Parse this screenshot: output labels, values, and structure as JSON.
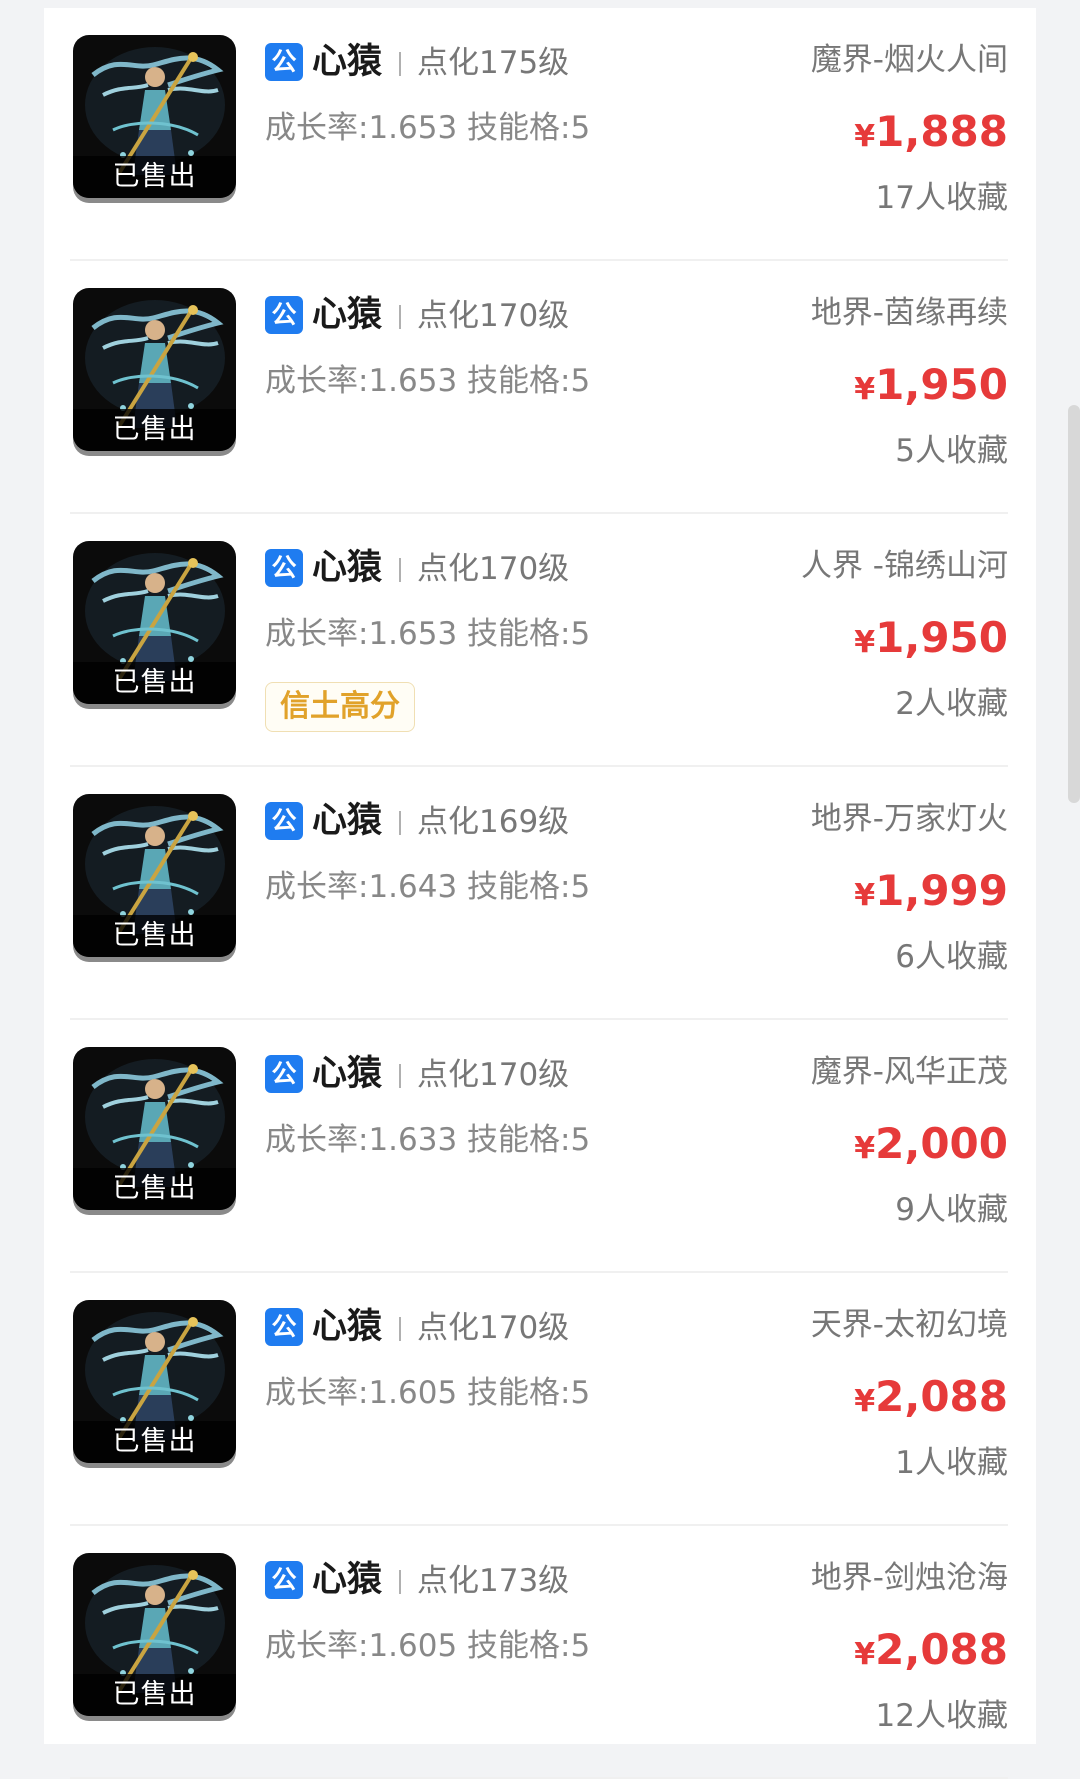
{
  "items": [
    {
      "badge": "公",
      "name": "心猿",
      "level": "点化175级",
      "stats": "成长率:1.653 技能格:5",
      "tag": "",
      "server": "魔界-烟火人间",
      "currency": "¥",
      "price": "1,888",
      "favorites": "17人收藏",
      "status": "已售出"
    },
    {
      "badge": "公",
      "name": "心猿",
      "level": "点化170级",
      "stats": "成长率:1.653 技能格:5",
      "tag": "",
      "server": "地界-茵缘再续",
      "currency": "¥",
      "price": "1,950",
      "favorites": "5人收藏",
      "status": "已售出"
    },
    {
      "badge": "公",
      "name": "心猿",
      "level": "点化170级",
      "stats": "成长率:1.653 技能格:5",
      "tag": "信土高分",
      "server": "人界 -锦绣山河",
      "currency": "¥",
      "price": "1,950",
      "favorites": "2人收藏",
      "status": "已售出"
    },
    {
      "badge": "公",
      "name": "心猿",
      "level": "点化169级",
      "stats": "成长率:1.643 技能格:5",
      "tag": "",
      "server": "地界-万家灯火",
      "currency": "¥",
      "price": "1,999",
      "favorites": "6人收藏",
      "status": "已售出"
    },
    {
      "badge": "公",
      "name": "心猿",
      "level": "点化170级",
      "stats": "成长率:1.633 技能格:5",
      "tag": "",
      "server": "魔界-风华正茂",
      "currency": "¥",
      "price": "2,000",
      "favorites": "9人收藏",
      "status": "已售出"
    },
    {
      "badge": "公",
      "name": "心猿",
      "level": "点化170级",
      "stats": "成长率:1.605 技能格:5",
      "tag": "",
      "server": "天界-太初幻境",
      "currency": "¥",
      "price": "2,088",
      "favorites": "1人收藏",
      "status": "已售出"
    },
    {
      "badge": "公",
      "name": "心猿",
      "level": "点化173级",
      "stats": "成长率:1.605 技能格:5",
      "tag": "",
      "server": "地界-剑烛沧海",
      "currency": "¥",
      "price": "2,088",
      "favorites": "12人收藏",
      "status": "已售出"
    }
  ],
  "colors": {
    "price": "#e63a3a",
    "badge": "#1f7cf0",
    "tag": "#e1a22a"
  }
}
